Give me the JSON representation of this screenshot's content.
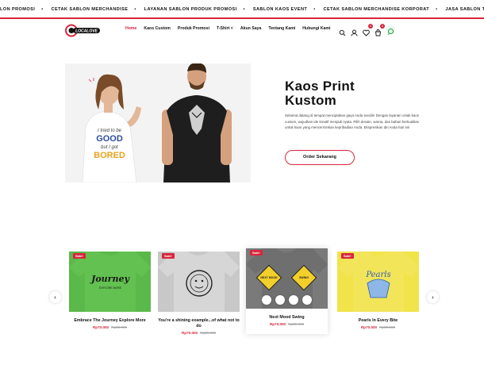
{
  "ticker": [
    "LON PROMOSI",
    "CETAK SABLON MERCHANDISE",
    "LAYANAN SABLON PRODUK PROMOSI",
    "SABLON KAOS EVENT",
    "CETAK SABLON MERCHANDISE KORPORAT",
    "JASA SABLON TAS"
  ],
  "brand": {
    "logo_text": "LOCALOVE",
    "accent": "#d7263d"
  },
  "menu": {
    "items": [
      {
        "label": "Home"
      },
      {
        "label": "Kaos Custom"
      },
      {
        "label": "Produk Promosi"
      },
      {
        "label": "T-Shirt ˅"
      },
      {
        "label": "Akun Saya"
      },
      {
        "label": "Tentang Kami"
      },
      {
        "label": "Hubungi Kami"
      }
    ]
  },
  "header": {
    "wishlist_count": "0",
    "cart_count": "0"
  },
  "hero": {
    "title_line1": "Kaos Print",
    "title_line2": "Kustom",
    "text": "Selamat datang di tempat menciptakan gaya Anda sendiri! Dengan layanan cetak kaos custom, wujudkan ide kreatif menjadi nyata. Pilih desain, warna, dan bahan berkualitas untuk kaos yang mencerminkan kepribadian Anda. Ekspresikan diri Anda hari ini!",
    "cta": "Order Sekarang",
    "shirt_text": "I tried to be GOOD but I got BORED"
  },
  "products": [
    {
      "name": "Embrace The Journey Explore More",
      "price": "Rp70.000",
      "old": "Rp80.000",
      "sale": "Sale!",
      "color": "#5bb84a",
      "print": "Journey"
    },
    {
      "name": "You're a shining example...of what not to do",
      "price": "Rp70.000",
      "old": "Rp80.000",
      "sale": "Sale!",
      "color": "#c8c8c8",
      "print": "shining"
    },
    {
      "name": "Next Mood Swing",
      "price": "Rp70.000",
      "old": "Rp80.000",
      "sale": "Sale!",
      "color": "#7a7a7a",
      "print": "NEXT MOOD SWING"
    },
    {
      "name": "Pearls In Every Bite",
      "price": "Rp70.000",
      "old": "Rp80.000",
      "sale": "Sale!",
      "color": "#f0e44a",
      "print": "Pearls"
    }
  ]
}
